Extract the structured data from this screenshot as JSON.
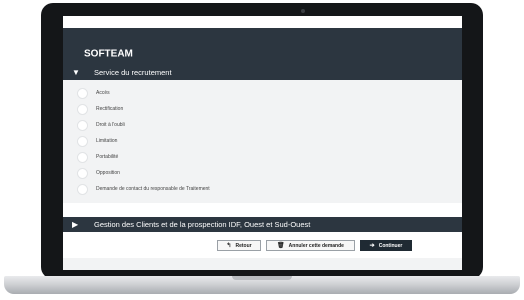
{
  "header": {
    "brand": "SOFTEAM"
  },
  "sections": [
    {
      "title": "Service du recrutement",
      "arrow": "▼",
      "options": [
        {
          "label": "Accès"
        },
        {
          "label": "Rectification"
        },
        {
          "label": "Droit à l'oubli"
        },
        {
          "label": "Limitation"
        },
        {
          "label": "Portabilité"
        },
        {
          "label": "Opposition"
        },
        {
          "label": "Demande de contact du responsable de Traitement"
        }
      ]
    },
    {
      "title": "Gestion des Clients et de la prospection IDF, Ouest et Sud-Ouest",
      "arrow": "▶"
    }
  ],
  "buttons": {
    "retour": {
      "label": "Retour",
      "icon": "↰"
    },
    "annuler": {
      "label": "Annuler cette demande",
      "icon": "🗑"
    },
    "continuer": {
      "label": "Continuer",
      "icon": "➔"
    }
  },
  "colors": {
    "header": "#2c3640",
    "options_bg": "#f2f3f4",
    "primary_button": "#1f2a33"
  }
}
